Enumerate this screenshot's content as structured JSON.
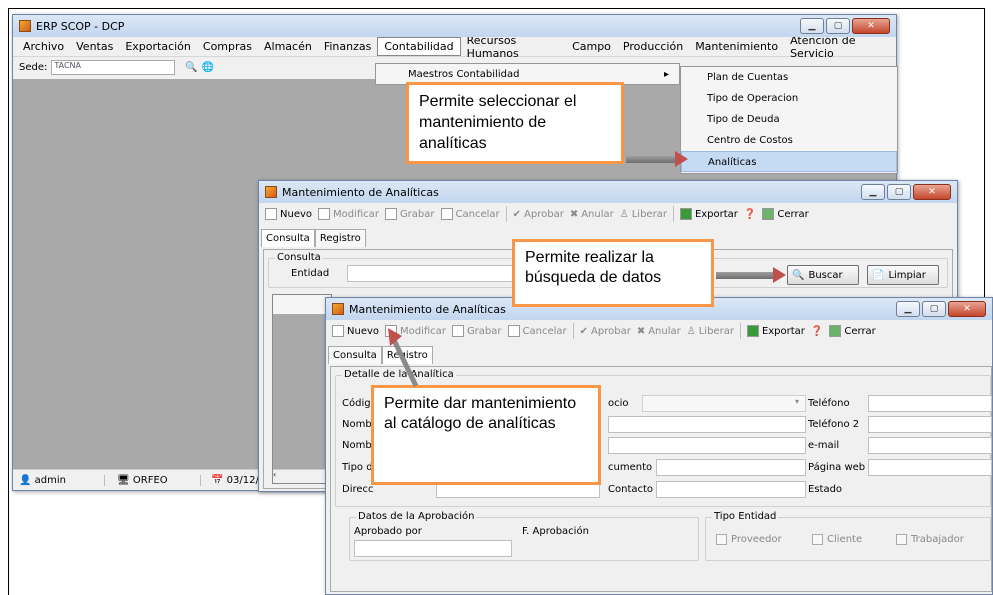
{
  "main_window": {
    "title": "ERP SCOP - DCP",
    "menu": [
      "Archivo",
      "Ventas",
      "Exportación",
      "Compras",
      "Almacén",
      "Finanzas",
      "Contabilidad",
      "Recursos Humanos",
      "Campo",
      "Producción",
      "Mantenimiento",
      "Atención de Servicio"
    ],
    "sede_label": "Sede:",
    "sede_value": "TACNA",
    "status": {
      "user": "admin",
      "host": "ORFEO",
      "date": "03/12/"
    }
  },
  "contabilidad_menu": {
    "item": "Maestros Contabilidad",
    "arrow": "▸"
  },
  "submenu": {
    "items": [
      "Plan de Cuentas",
      "Tipo de Operacion",
      "Tipo de Deuda",
      "Centro de Costos",
      "Analíticas"
    ]
  },
  "window2": {
    "title": "Mantenimiento de Analíticas",
    "toolbar": [
      "Nuevo",
      "Modificar",
      "Grabar",
      "Cancelar",
      "Aprobar",
      "Anular",
      "Liberar",
      "Exportar",
      "Cerrar"
    ],
    "tabs": [
      "Consulta",
      "Registro"
    ],
    "group": "Consulta",
    "entidad_label": "Entidad",
    "buscar": "Buscar",
    "limpiar": "Limpiar"
  },
  "window3": {
    "title": "Mantenimiento de Analíticas",
    "toolbar": [
      "Nuevo",
      "Modificar",
      "Grabar",
      "Cancelar",
      "Aprobar",
      "Anular",
      "Liberar",
      "Exportar",
      "Cerrar"
    ],
    "tabs": [
      "Consulta",
      "Registro"
    ],
    "detalle_group": "Detalle de la Analítica",
    "left_labels": [
      "Códig",
      "Nomb",
      "Nomb",
      "Tipo d",
      "Direcc"
    ],
    "mid_labels": [
      "ocio",
      "cumento",
      "Contacto"
    ],
    "right_labels": [
      "Teléfono",
      "Teléfono 2",
      "e-mail",
      "Página web",
      "Estado"
    ],
    "aprob_group": "Datos de la Aprobación",
    "aprobado_por": "Aprobado por",
    "f_aprobacion": "F. Aprobación",
    "tipo_group": "Tipo Entidad",
    "tipo_options": [
      "Proveedor",
      "Cliente",
      "Trabajador"
    ]
  },
  "callouts": {
    "one": "Permite seleccionar el mantenimiento de analíticas",
    "two": "Permite realizar la búsqueda de datos",
    "three": "Permite dar mantenimiento al catálogo de analíticas"
  }
}
